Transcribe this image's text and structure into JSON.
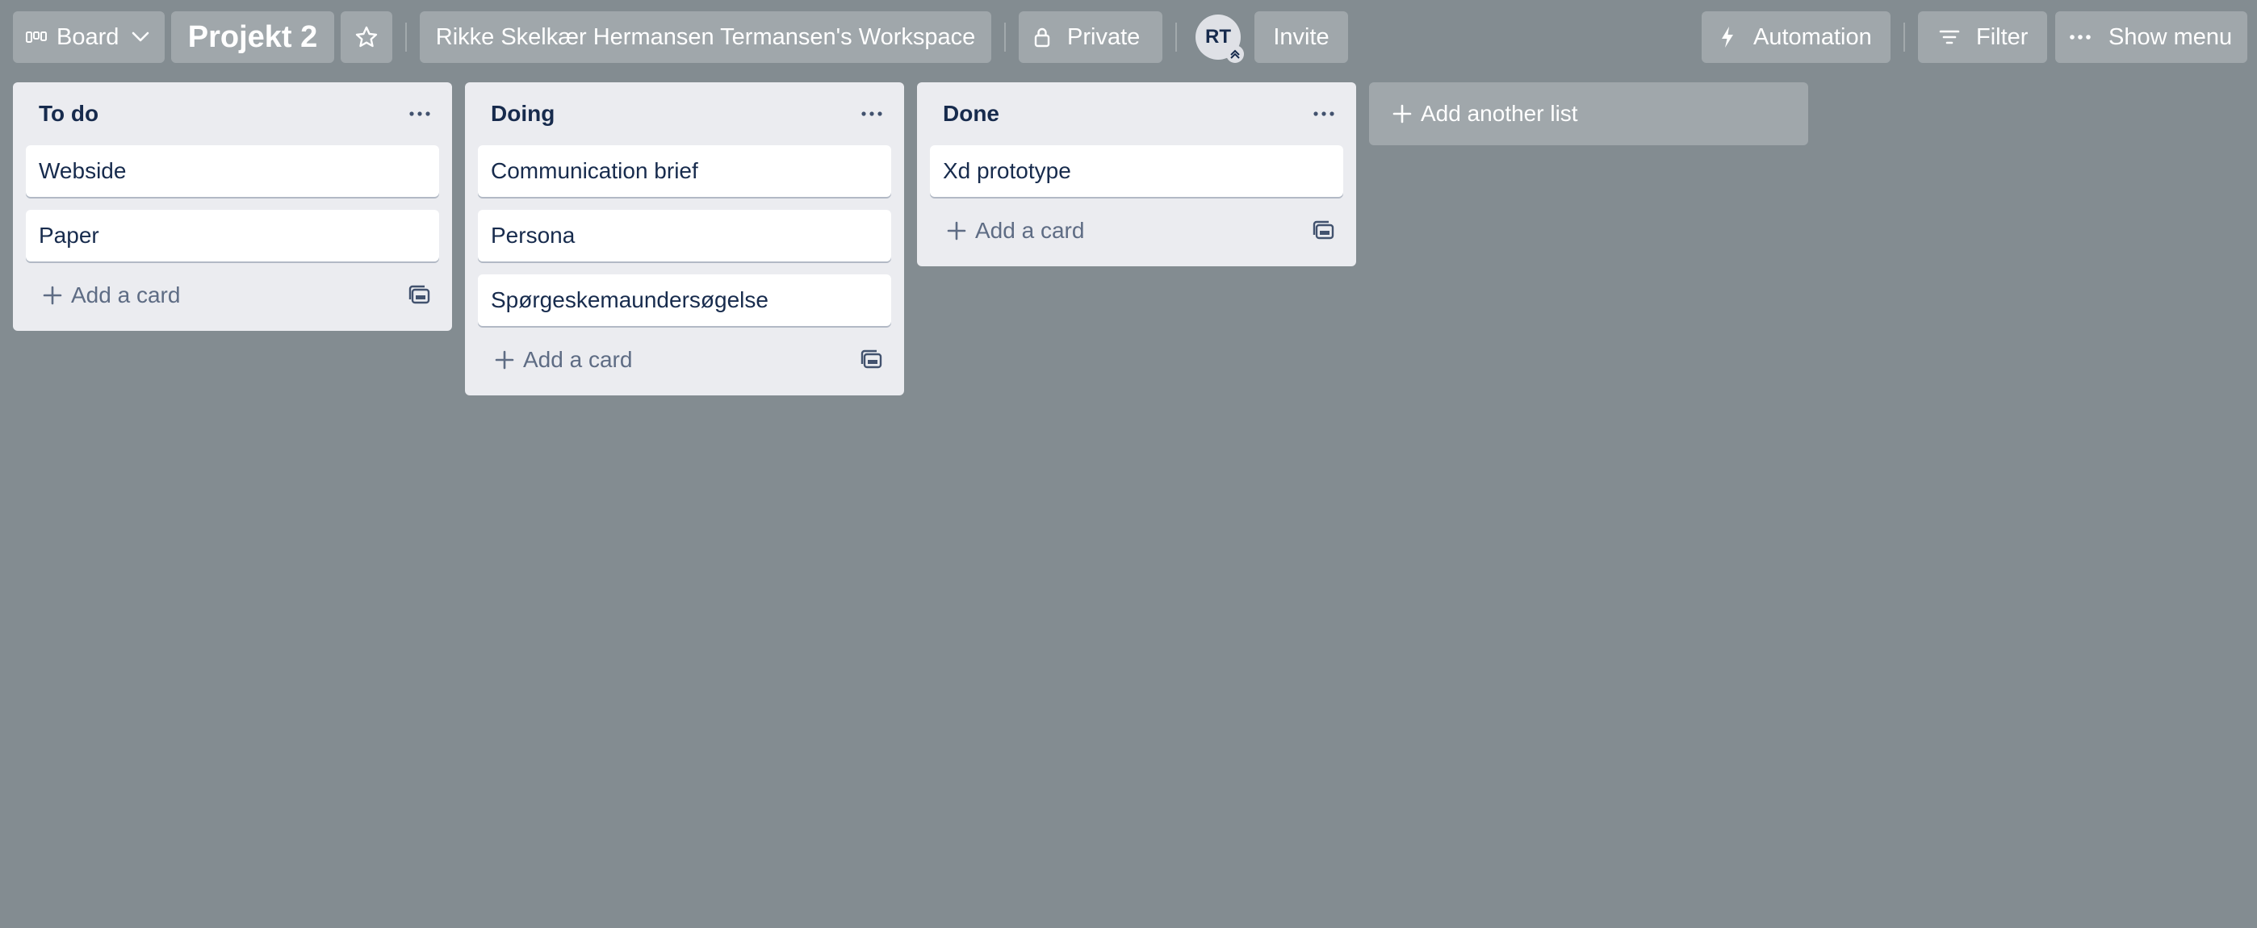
{
  "header": {
    "view_switch": {
      "label": "Board",
      "icon": "board-icon"
    },
    "board_title": "Projekt 2",
    "star_icon": "star-icon",
    "workspace": "Rikke Skelkær Hermansen Termansen's Workspace",
    "visibility": {
      "label": "Private",
      "icon": "lock-icon"
    },
    "member_avatar": "RT",
    "invite_label": "Invite",
    "automation": {
      "label": "Automation",
      "icon": "lightning-icon"
    },
    "filter": {
      "label": "Filter",
      "icon": "filter-icon"
    },
    "show_menu": {
      "label": "Show menu",
      "icon": "more-icon"
    }
  },
  "lists": [
    {
      "title": "To do",
      "cards": [
        "Webside",
        "Paper"
      ],
      "add_card_label": "Add a card"
    },
    {
      "title": "Doing",
      "cards": [
        "Communication brief",
        "Persona",
        "Spørgeskemaundersøgelse"
      ],
      "add_card_label": "Add a card"
    },
    {
      "title": "Done",
      "cards": [
        "Xd prototype"
      ],
      "add_card_label": "Add a card"
    }
  ],
  "add_list_label": "Add another list",
  "colors": {
    "board_background": "#838c91",
    "list_background": "#ebecf0",
    "text_primary": "#172b4d",
    "text_secondary": "#5e6c84"
  }
}
